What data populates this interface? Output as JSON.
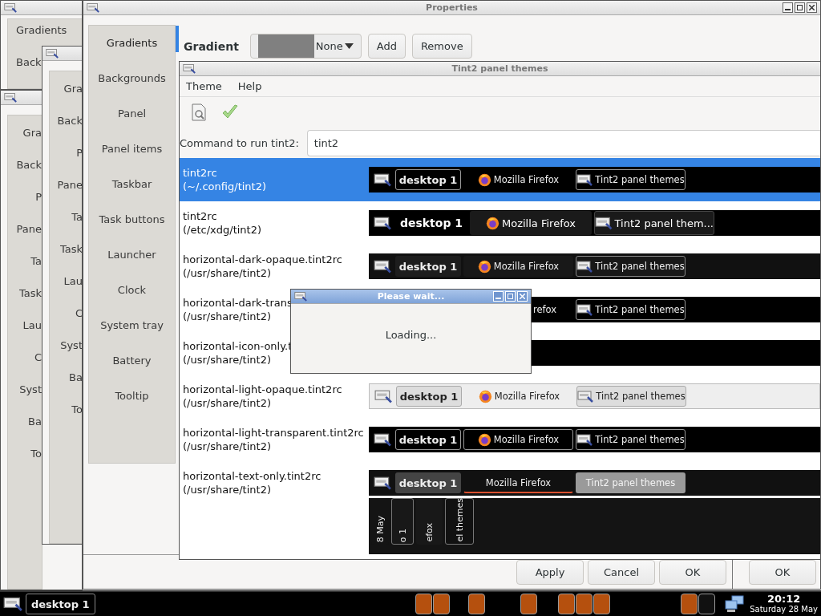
{
  "back_windows": [
    {
      "items": [
        "Gradients",
        "Back"
      ]
    },
    {
      "items": [
        "Gra",
        "Back",
        "P",
        "Pane",
        "Ta",
        "Task",
        "Lau",
        "C",
        "Syst",
        "Ba",
        "To"
      ]
    },
    {
      "items": [
        "Gra",
        "Back",
        "P",
        "Pane",
        "Ta",
        "Task",
        "Lau",
        "C",
        "Syst",
        "Ba",
        "To"
      ]
    }
  ],
  "properties": {
    "title": "Properties",
    "tabs": [
      {
        "label": "Gradients",
        "selected": true
      },
      {
        "label": "Backgrounds",
        "selected": false
      },
      {
        "label": "Panel",
        "selected": false
      },
      {
        "label": "Panel items",
        "selected": false
      },
      {
        "label": "Taskbar",
        "selected": false
      },
      {
        "label": "Task buttons",
        "selected": false
      },
      {
        "label": "Launcher",
        "selected": false
      },
      {
        "label": "Clock",
        "selected": false
      },
      {
        "label": "System tray",
        "selected": false
      },
      {
        "label": "Battery",
        "selected": false
      },
      {
        "label": "Tooltip",
        "selected": false
      }
    ],
    "gradient": {
      "label": "Gradient",
      "value": "None"
    },
    "buttons": [
      "Add",
      "Remove"
    ],
    "footer_buttons": [
      "Apply",
      "Cancel",
      "OK",
      "OK"
    ]
  },
  "themes_window": {
    "title": "Tint2 panel themes",
    "menu": [
      "Theme",
      "Help"
    ],
    "command": {
      "label": "Command to run tint2:",
      "value": "tint2"
    },
    "themes": [
      {
        "name": "tint2rc",
        "path": "(~/.config/tint2)",
        "selected": true,
        "preview": {
          "kind": "dark",
          "launcher": true,
          "desktop": "desktop 1",
          "tasks": [
            {
              "kind": "firefox",
              "label": "Mozilla Firefox",
              "active": false
            },
            {
              "kind": "window",
              "label": "Tint2 panel themes",
              "active": true
            }
          ]
        }
      },
      {
        "name": "tint2rc",
        "path": "(/etc/xdg/tint2)",
        "selected": false,
        "preview": {
          "kind": "large",
          "launcher": true,
          "desktop": "desktop 1",
          "tasks": [
            {
              "kind": "firefox",
              "label": "Mozilla Firefox",
              "active": false
            },
            {
              "kind": "window",
              "label": "Tint2 panel them...",
              "active": true
            }
          ]
        }
      },
      {
        "name": "horizontal-dark-opaque.tint2rc",
        "path": "(/usr/share/tint2)",
        "selected": false,
        "preview": {
          "kind": "opaque",
          "launcher": true,
          "desktop": "desktop 1",
          "tasks": [
            {
              "kind": "firefox",
              "label": "Mozilla Firefox",
              "active": false
            },
            {
              "kind": "window",
              "label": "Tint2 panel themes",
              "active": true
            }
          ]
        }
      },
      {
        "name": "horizontal-dark-trans",
        "path": "(/usr/share/tint2)",
        "selected": false,
        "preview": {
          "kind": "dark",
          "launcher": false,
          "tasks": [
            {
              "kind": "text",
              "label": "refox",
              "active": false
            },
            {
              "kind": "window",
              "label": "Tint2 panel themes",
              "active": true
            }
          ]
        }
      },
      {
        "name": "horizontal-icon-only.t",
        "path": "(/usr/share/tint2)",
        "selected": false,
        "preview": {
          "kind": "dark"
        }
      },
      {
        "name": "horizontal-light-opaque.tint2rc",
        "path": "(/usr/share/tint2)",
        "selected": false,
        "preview": {
          "kind": "light",
          "launcher": true,
          "desktop": "desktop 1",
          "tasks": [
            {
              "kind": "firefox",
              "label": "Mozilla Firefox",
              "active": false
            },
            {
              "kind": "window",
              "label": "Tint2 panel themes",
              "active": true
            }
          ]
        }
      },
      {
        "name": "horizontal-light-transparent.tint2rc",
        "path": "(/usr/share/tint2)",
        "selected": false,
        "preview": {
          "kind": "boxed",
          "launcher": true,
          "desktop": "desktop 1",
          "tasks": [
            {
              "kind": "firefox",
              "label": "Mozilla Firefox"
            },
            {
              "kind": "window",
              "label": "Tint2 panel themes"
            }
          ]
        }
      },
      {
        "name": "horizontal-text-only.tint2rc",
        "path": "(/usr/share/tint2)",
        "selected": false,
        "preview": {
          "kind": "text",
          "launcher": true,
          "desktop": "desktop 1",
          "tasks": [
            {
              "kind": "text",
              "label": "Mozilla Firefox",
              "active": false
            },
            {
              "kind": "text",
              "label": "Tint2 panel themes",
              "active": true
            }
          ]
        }
      },
      {
        "selected": false,
        "preview": {
          "kind": "vertical",
          "clock": "8 May",
          "desktop": "o 1",
          "tasks": [
            {
              "label": "efox",
              "active": false
            },
            {
              "label": "el themes",
              "active": true
            }
          ]
        }
      }
    ]
  },
  "dialog": {
    "title": "Please wait...",
    "message": "Loading..."
  },
  "taskbar": {
    "desktop": "desktop 1",
    "task_groups": [
      {
        "tasks": [
          {
            "color": "#b5500e"
          },
          {
            "color": "#b5500e"
          }
        ]
      },
      {
        "tasks": [
          {
            "color": "#b5500e"
          }
        ]
      },
      {
        "tasks": [
          {
            "color": "#b5500e"
          }
        ]
      },
      {
        "tasks": [
          {
            "color": "#b5500e"
          },
          {
            "color": "#b5500e"
          },
          {
            "color": "#b5500e"
          }
        ]
      },
      {
        "tasks": [
          {
            "color": "#b5500e"
          },
          {
            "color": "#111111"
          }
        ]
      }
    ],
    "time": "20:12",
    "date": "Saturday 28 May"
  }
}
